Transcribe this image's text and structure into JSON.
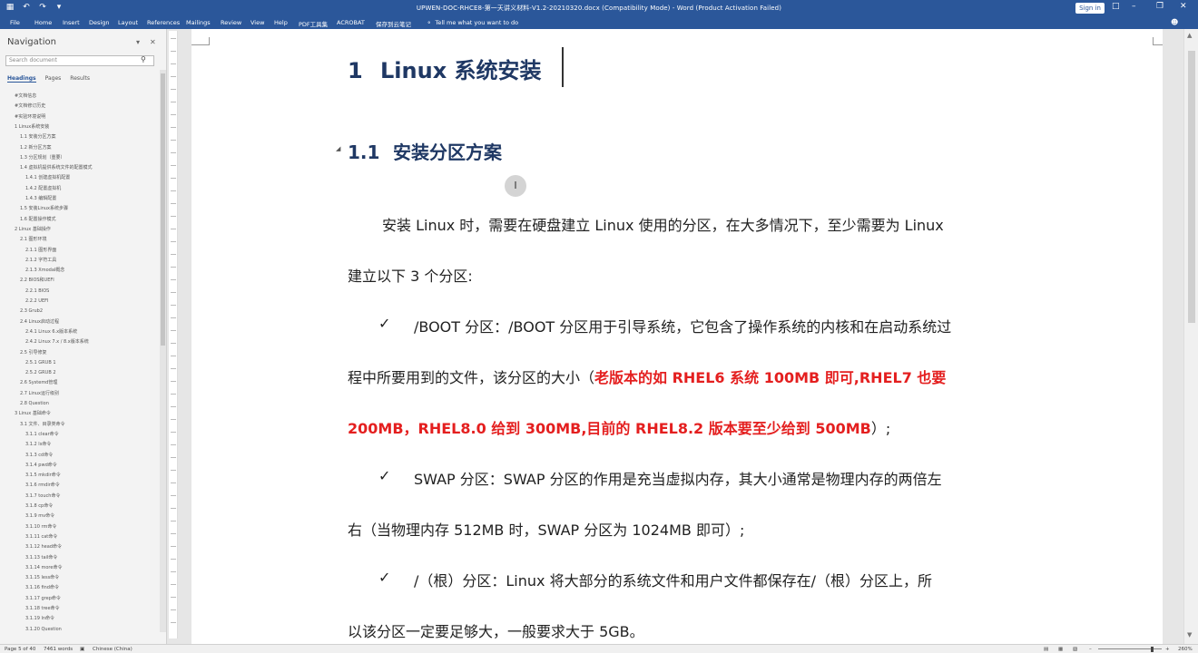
{
  "titlebar": {
    "title": "UPWEN-DOC-RHCE8-第一天讲义材料-V1.2-20210320.docx (Compatibility Mode) - Word (Product Activation Failed)",
    "signin": "Sign in",
    "qat_icons": [
      "save-icon",
      "undo-icon",
      "redo-icon",
      "customize-icon"
    ],
    "window_controls": [
      "minimize-icon",
      "restore-icon",
      "close-icon"
    ]
  },
  "menu": {
    "tabs": [
      "File",
      "Home",
      "Insert",
      "Design",
      "Layout",
      "References",
      "Mailings",
      "Review",
      "View",
      "Help",
      "PDF工具集",
      "ACROBAT",
      "保存到云笔记"
    ],
    "tell_me": "Tell me what you want to do",
    "share_icon": "share-icon"
  },
  "nav": {
    "title": "Navigation",
    "search_placeholder": "Search document",
    "tabs": [
      "Headings",
      "Pages",
      "Results"
    ],
    "outline": [
      "#文档信息",
      "#文档修订历史",
      "#实验环境说明",
      "1 Linux系统安装",
      "1.1 安装分区方案",
      "1.2 新分区方案",
      "1.3 分区规划（重要）",
      "1.4 虚拟机提供系统文件的配置模式",
      "1.4.1 创建虚拟机配置",
      "1.4.2 配置虚拟机",
      "1.4.3 编辑配置",
      "1.5 安装Linux系统步骤",
      "1.6 配置操作模式",
      "2 Linux 基础操作",
      "2.1 图形环境",
      "2.1.1 图形界面",
      "2.1.2 字符工具",
      "2.1.3 Xmodal概念",
      "2.2 BIOS和UEFI",
      "2.2.1 BIOS",
      "2.2.2 UEFI",
      "2.3 Grub2",
      "2.4 Linux启动过程",
      "2.4.1 Linux 6.x版本系统",
      "2.4.2 Linux 7.x / 8.x版本系统",
      "2.5 引导修复",
      "2.5.1 GRUB 1",
      "2.5.2 GRUB 2",
      "2.6 Systemd管理",
      "2.7 Linux运行级别",
      "2.8 Question",
      "3 Linux 基础命令",
      "3.1 文件、目录类命令",
      "3.1.1 clear命令",
      "3.1.2 ls命令",
      "3.1.3 cd命令",
      "3.1.4 pwd命令",
      "3.1.5 mkdir命令",
      "3.1.6 rmdir命令",
      "3.1.7 touch命令",
      "3.1.8 cp命令",
      "3.1.9 mv命令",
      "3.1.10 rm命令",
      "3.1.11 cat命令",
      "3.1.12 head命令",
      "3.1.13 tail命令",
      "3.1.14 more命令",
      "3.1.15 less命令",
      "3.1.16 find命令",
      "3.1.17 grep命令",
      "3.1.18 tree命令",
      "3.1.19 ln命令",
      "3.1.20 Question"
    ]
  },
  "document": {
    "h1_num": "1",
    "h1_text": "Linux 系统安装",
    "h2_num": "1.1",
    "h2_text": "安装分区方案",
    "para1_line1": "安装 Linux 时，需要在硬盘建立 Linux 使用的分区，在大多情况下，至少需要为 Linux",
    "para1_line2": "建立以下 3 个分区:",
    "check_mark": "✓",
    "boot_line1": "/BOOT 分区：/BOOT 分区用于引导系统，它包含了操作系统的内核和在启动系统过",
    "boot_line2_normal": "程中所要用到的文件，该分区的大小（",
    "boot_line2_red": "老版本的如 RHEL6 系统 100MB 即可,RHEL7 也要",
    "boot_line3_red": "200MB，RHEL8.0 给到 300MB,目前的 RHEL8.2 版本要至少给到 500MB",
    "boot_line3_end": "）;",
    "swap_line1": "SWAP 分区：SWAP 分区的作用是充当虚拟内存，其大小通常是物理内存的两倍左",
    "swap_line2": "右（当物理内存 512MB 时，SWAP 分区为 1024MB 即可）;",
    "root_line1": "/（根）分区：Linux 将大部分的系统文件和用户文件都保存在/（根）分区上，所",
    "root_line2": "以该分区一定要足够大，一般要求大于 5GB。"
  },
  "status": {
    "page": "Page 5 of 40",
    "words": "7461 words",
    "language": "Chinese (China)",
    "zoom": "260%"
  },
  "colors": {
    "accent": "#2b579a",
    "heading": "#1f3864",
    "highlight_red": "#e41f1f"
  }
}
